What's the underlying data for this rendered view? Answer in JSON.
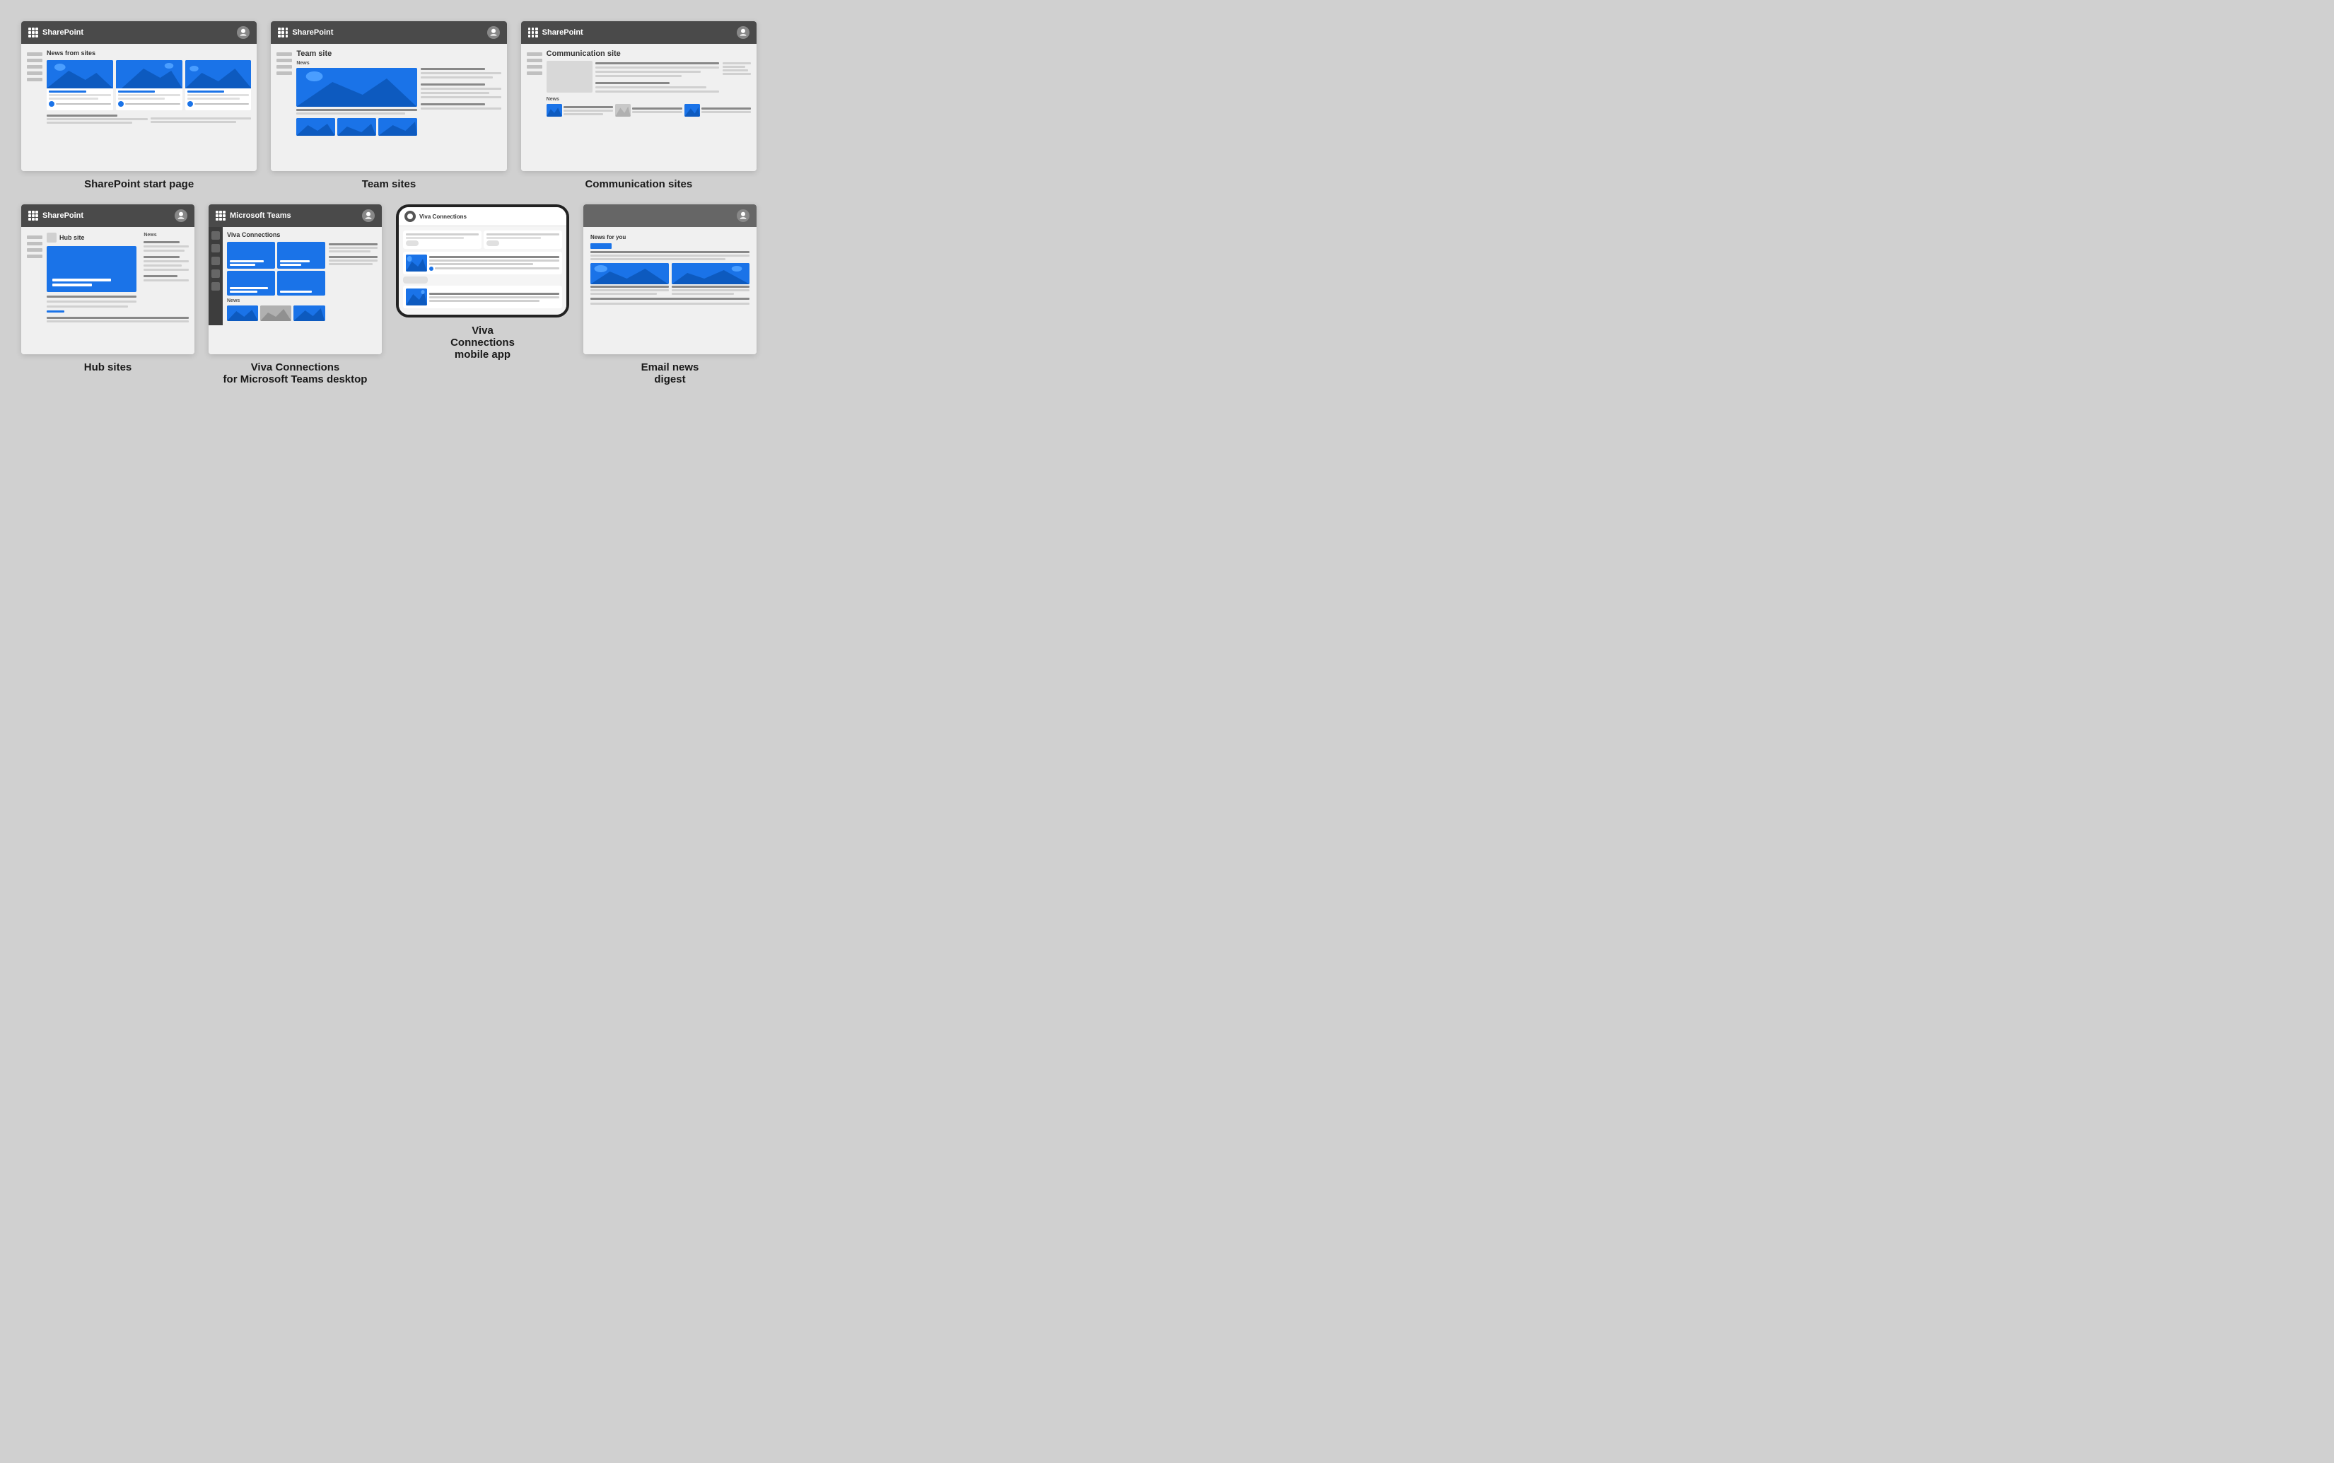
{
  "background": "#d0d0d0",
  "colors": {
    "blue": "#1a73e8",
    "darkHeader": "#4a4a4a",
    "teamsHeader": "#3d3d3d",
    "lightGray": "#d0d0d0",
    "medGray": "#888",
    "white": "#ffffff",
    "bodyBg": "#f0f0f0"
  },
  "row1": [
    {
      "id": "sharepoint-start",
      "header_app": "SharePoint",
      "label": "SharePoint start page",
      "type": "start-page"
    },
    {
      "id": "team-sites",
      "header_app": "SharePoint",
      "label": "Team sites",
      "page_title": "Team site",
      "news_label": "News",
      "type": "team-site"
    },
    {
      "id": "communication-sites",
      "header_app": "SharePoint",
      "label": "Communication sites",
      "page_title": "Communication site",
      "news_label": "News",
      "type": "communication-site"
    }
  ],
  "row2": [
    {
      "id": "hub-sites",
      "header_app": "SharePoint",
      "label": "Hub sites",
      "page_title": "Hub site",
      "news_label": "News",
      "type": "hub-site"
    },
    {
      "id": "viva-connections-teams",
      "header_app": "Microsoft Teams",
      "label": "Viva Connections\nfor Microsoft Teams desktop",
      "page_title": "Viva Connections",
      "news_label": "News",
      "type": "viva-teams"
    },
    {
      "id": "viva-connections-mobile",
      "label": "Viva\nConnections\nmobile app",
      "app_title": "Viva Connections",
      "type": "viva-mobile"
    },
    {
      "id": "email-news-digest",
      "label": "Email news\ndigest",
      "page_title": "News for you",
      "type": "email-digest"
    }
  ]
}
